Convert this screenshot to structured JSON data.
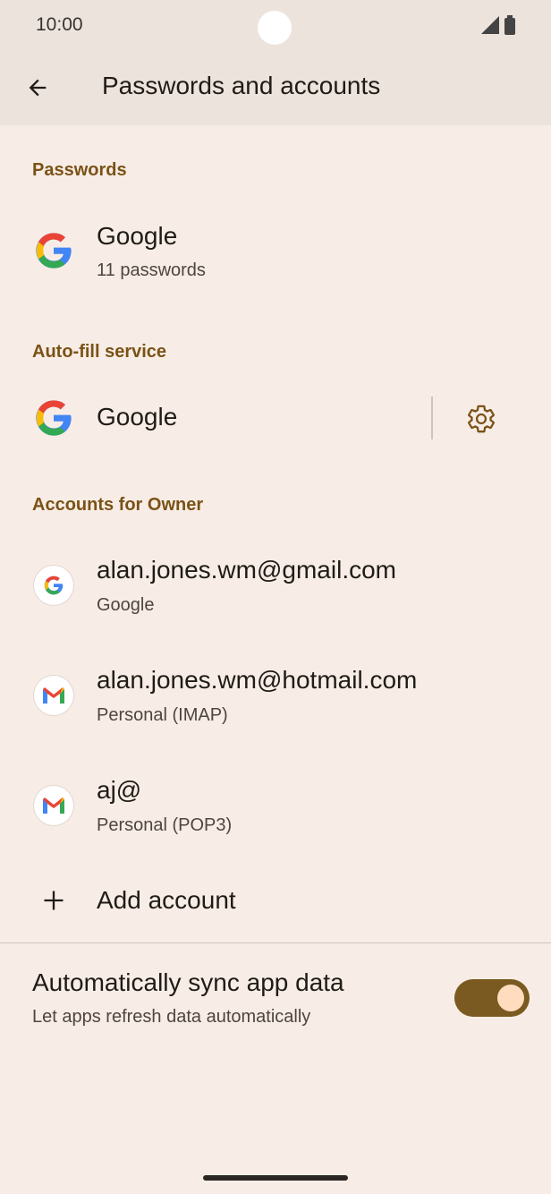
{
  "status_bar": {
    "time": "10:00"
  },
  "app_bar": {
    "title": "Passwords and accounts"
  },
  "passwords": {
    "header": "Passwords",
    "provider": "Google",
    "count": "11 passwords"
  },
  "autofill": {
    "header": "Auto-fill service",
    "provider": "Google"
  },
  "accounts": {
    "header": "Accounts for Owner",
    "items": [
      {
        "email": "alan.jones.wm@gmail.com",
        "type": "Google",
        "icon": "google-icon"
      },
      {
        "email": "alan.jones.wm@hotmail.com",
        "type": "Personal (IMAP)",
        "icon": "gmail-icon"
      },
      {
        "email": "aj@",
        "type": "Personal (POP3)",
        "icon": "gmail-icon"
      }
    ],
    "add_label": "Add account"
  },
  "sync": {
    "title": "Automatically sync app data",
    "subtitle": "Let apps refresh data automatically",
    "enabled": true
  },
  "colors": {
    "accent": "#7a5216",
    "toggle_track": "#7a5a20",
    "background": "#f7ede6"
  }
}
